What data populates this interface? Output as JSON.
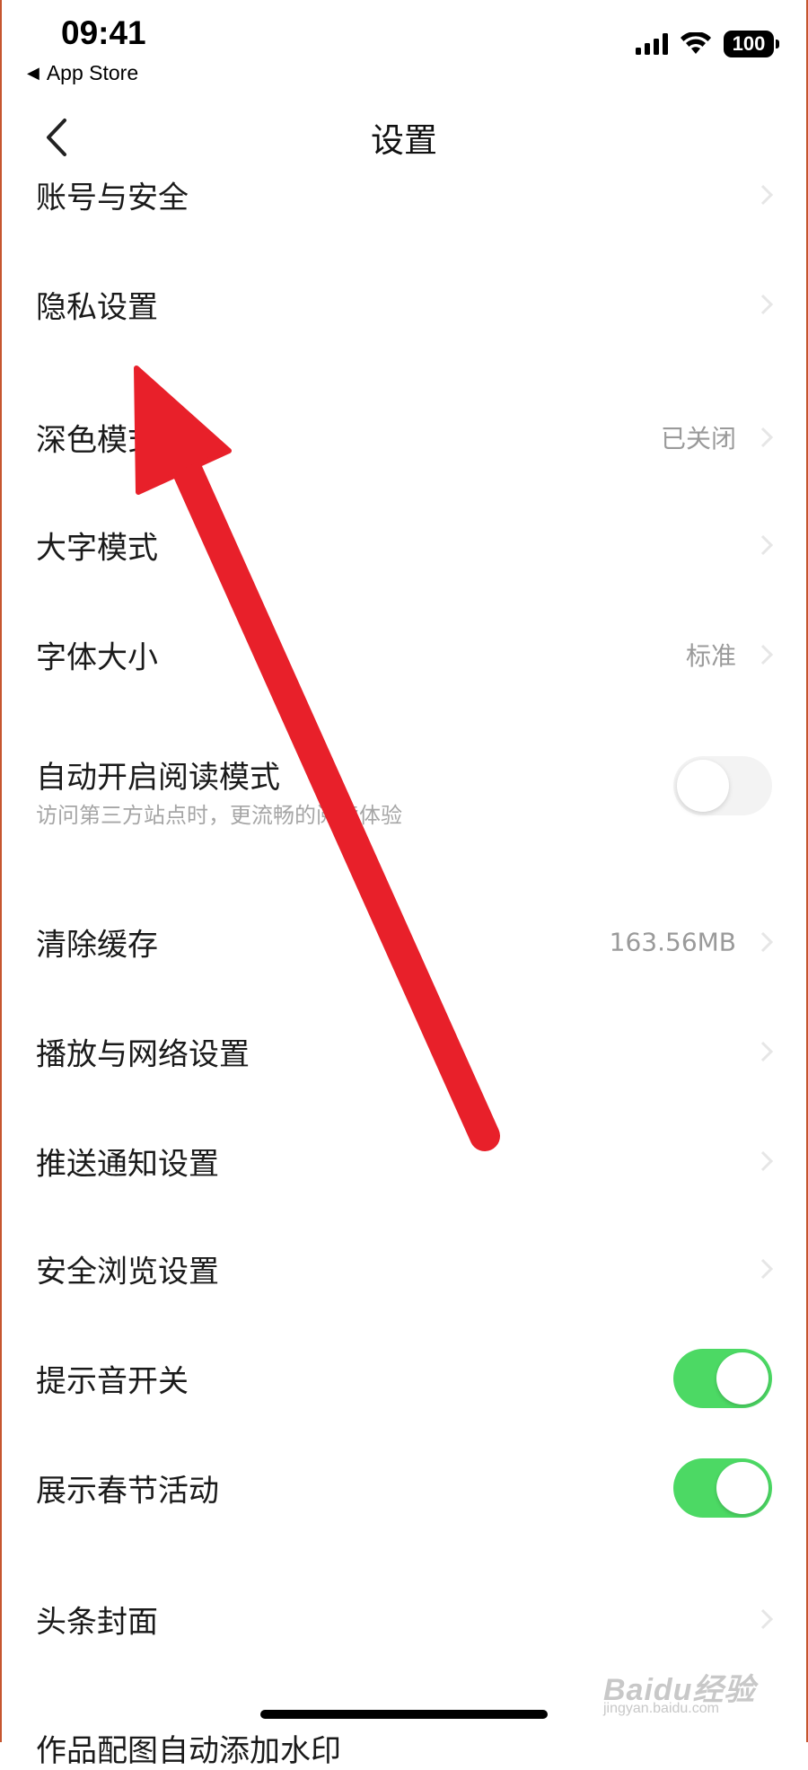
{
  "status_bar": {
    "time": "09:41",
    "back_app": "App Store",
    "battery": "100"
  },
  "nav": {
    "title": "设置"
  },
  "rows": [
    {
      "label": "账号与安全"
    },
    {
      "label": "隐私设置"
    },
    {
      "label": "深色模式",
      "value": "已关闭"
    },
    {
      "label": "大字模式"
    },
    {
      "label": "字体大小",
      "value": "标准"
    },
    {
      "label": "自动开启阅读模式",
      "sub": "访问第三方站点时，更流畅的阅读体验",
      "toggle": false
    },
    {
      "label": "清除缓存",
      "value": "163.56MB"
    },
    {
      "label": "播放与网络设置"
    },
    {
      "label": "推送通知设置"
    },
    {
      "label": "安全浏览设置"
    },
    {
      "label": "提示音开关",
      "toggle": true
    },
    {
      "label": "展示春节活动",
      "toggle": true
    },
    {
      "label": "头条封面"
    },
    {
      "label": "作品配图自动添加水印"
    }
  ],
  "watermark": {
    "logo": "Baidu经验",
    "url": "jingyan.baidu.com"
  },
  "colors": {
    "toggle_on": "#4cd964",
    "arrow": "#e8202a",
    "secondary_text": "#9a9a9a"
  }
}
